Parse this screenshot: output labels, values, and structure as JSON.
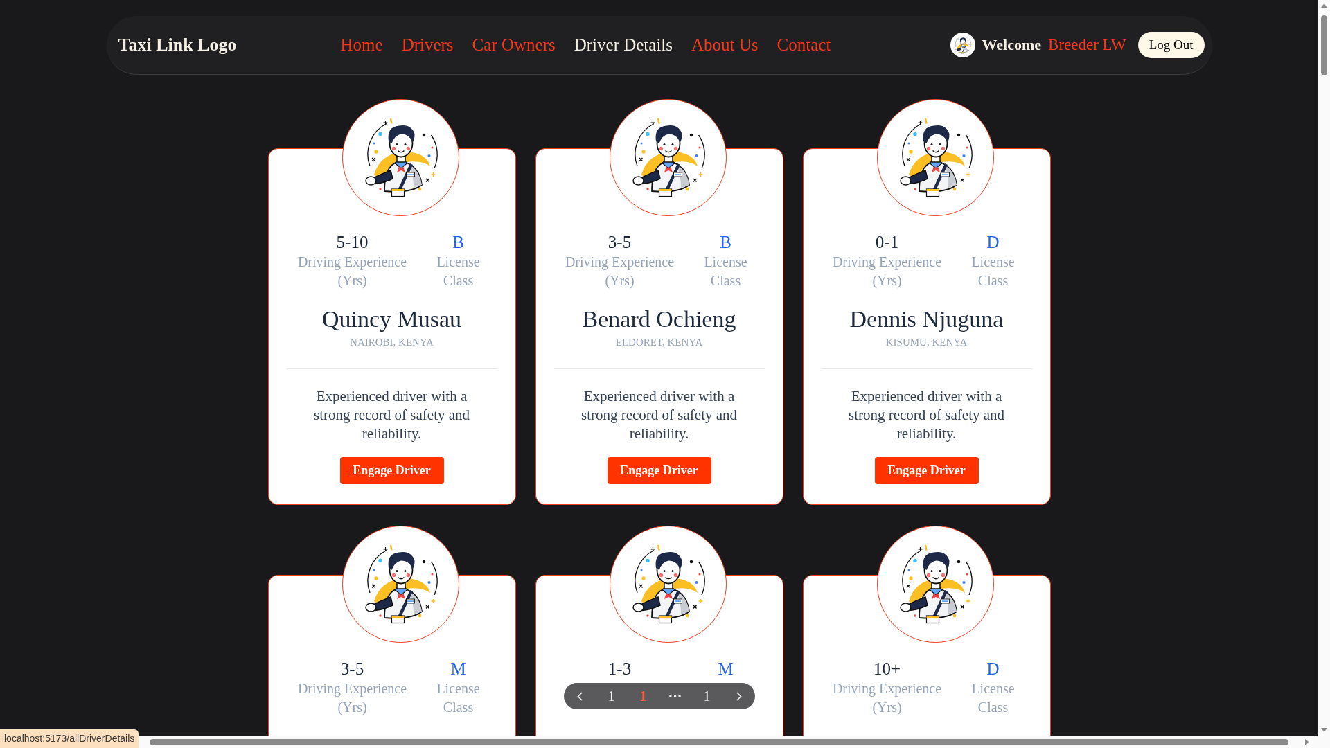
{
  "navbar": {
    "logo": "Taxi Link Logo",
    "links": [
      {
        "label": "Home",
        "selected": false
      },
      {
        "label": "Drivers",
        "selected": false
      },
      {
        "label": "Car Owners",
        "selected": false
      },
      {
        "label": "Driver Details",
        "selected": true
      },
      {
        "label": "About Us",
        "selected": false
      },
      {
        "label": "Contact",
        "selected": false
      }
    ],
    "greeting": "Welcome",
    "user_name": "Breeder LW",
    "logout_button": "Log Out"
  },
  "drivers": [
    {
      "experience": "5-10",
      "experience_label": "Driving Experience (Yrs)",
      "license_class": "B",
      "class_label": "License Class",
      "name": "Quincy Musau",
      "location": "NAIROBI, KENYA",
      "description": "Experienced driver with a strong record of safety and reliability.",
      "button": "Engage Driver"
    },
    {
      "experience": "3-5",
      "experience_label": "Driving Experience (Yrs)",
      "license_class": "B",
      "class_label": "License Class",
      "name": "Benard Ochieng",
      "location": "ELDORET, KENYA",
      "description": "Experienced driver with a strong record of safety and reliability.",
      "button": "Engage Driver"
    },
    {
      "experience": "0-1",
      "experience_label": "Driving Experience (Yrs)",
      "license_class": "D",
      "class_label": "License Class",
      "name": "Dennis Njuguna",
      "location": "KISUMU, KENYA",
      "description": "Experienced driver with a strong record of safety and reliability.",
      "button": "Engage Driver"
    },
    {
      "experience": "3-5",
      "experience_label": "Driving Experience (Yrs)",
      "license_class": "M",
      "class_label": "License Class"
    },
    {
      "experience": "1-3",
      "license_class": "M"
    },
    {
      "experience": "10+",
      "experience_label": "Driving Experience (Yrs)",
      "license_class": "D",
      "class_label": "License Class"
    }
  ],
  "pagination": {
    "pages": [
      {
        "kind": "page",
        "label": "1",
        "selected": false
      },
      {
        "kind": "page",
        "label": "1",
        "selected": true
      },
      {
        "kind": "ellipsis",
        "label": "···",
        "selected": false
      },
      {
        "kind": "page",
        "label": "1",
        "selected": false
      }
    ]
  },
  "status_bar": {
    "url": "localhost:5173/allDriverDetails"
  }
}
